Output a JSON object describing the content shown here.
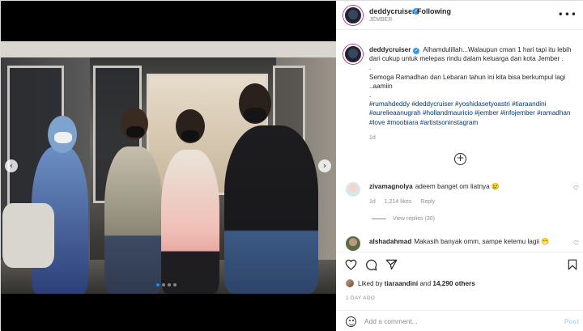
{
  "post": {
    "username": "deddycruiser",
    "verified_mark": "✓",
    "follow_status": "Following",
    "location": "JEMBER",
    "more_icon": "more-horizontal-icon"
  },
  "media": {
    "carousel_index": 1,
    "carousel_total": 4,
    "prev_arrow": "‹",
    "next_arrow": "›"
  },
  "caption": {
    "username": "deddycruiser",
    "line1": "Alhamdulillah...Walaupun cman 1 hari tapi itu lebih dari cukup untuk melepas rindu dalam keluarga dan kota Jember .",
    "dash1": ".",
    "line2": "Semoga Ramadhan dan Lebaran tahun ini kita bisa berkumpul lagi ..aamiin",
    "dash2": ".",
    "hashtags": "#rumahdeddy #deddycruiser #yoshidasetyoastri #tiaraandini #aurelieaanugrah #hollandmauricio #jember #infojember #ramadhan #love #moobiara #artistsoninstagram",
    "time": "1d"
  },
  "load_more_icon": "+",
  "comments": [
    {
      "username": "zivamagnolya",
      "text": "adeem banget om liatnya 😢",
      "time": "1d",
      "likes": "1,214 likes",
      "reply": "Reply",
      "view_replies": "View replies (30)"
    },
    {
      "username": "alshadahmad",
      "text": "Makasih banyak omm, sampe ketemu lagii 😁"
    }
  ],
  "likes": {
    "prefix": "Liked by",
    "user": "tiaraandini",
    "conjunction": "and",
    "count": "14,290 others"
  },
  "timestamp": "1 DAY AGO",
  "add_comment": {
    "placeholder": "Add a comment...",
    "post_label": "Post"
  },
  "colors": {
    "link": "#00376b",
    "verified": "#3897f0",
    "muted": "#8e8e8e",
    "post_disabled": "#b3dbff"
  }
}
